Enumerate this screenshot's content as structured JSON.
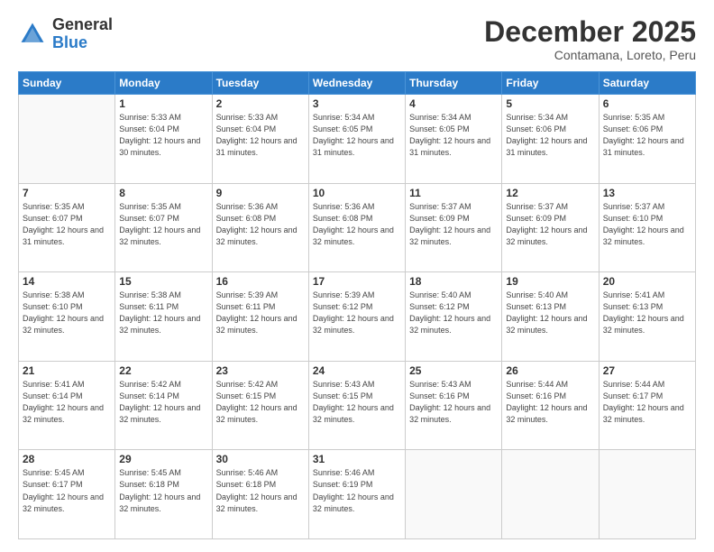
{
  "logo": {
    "general": "General",
    "blue": "Blue"
  },
  "header": {
    "month": "December 2025",
    "location": "Contamana, Loreto, Peru"
  },
  "weekdays": [
    "Sunday",
    "Monday",
    "Tuesday",
    "Wednesday",
    "Thursday",
    "Friday",
    "Saturday"
  ],
  "weeks": [
    [
      {
        "day": "",
        "sunrise": "",
        "sunset": "",
        "daylight": ""
      },
      {
        "day": "1",
        "sunrise": "Sunrise: 5:33 AM",
        "sunset": "Sunset: 6:04 PM",
        "daylight": "Daylight: 12 hours and 30 minutes."
      },
      {
        "day": "2",
        "sunrise": "Sunrise: 5:33 AM",
        "sunset": "Sunset: 6:04 PM",
        "daylight": "Daylight: 12 hours and 31 minutes."
      },
      {
        "day": "3",
        "sunrise": "Sunrise: 5:34 AM",
        "sunset": "Sunset: 6:05 PM",
        "daylight": "Daylight: 12 hours and 31 minutes."
      },
      {
        "day": "4",
        "sunrise": "Sunrise: 5:34 AM",
        "sunset": "Sunset: 6:05 PM",
        "daylight": "Daylight: 12 hours and 31 minutes."
      },
      {
        "day": "5",
        "sunrise": "Sunrise: 5:34 AM",
        "sunset": "Sunset: 6:06 PM",
        "daylight": "Daylight: 12 hours and 31 minutes."
      },
      {
        "day": "6",
        "sunrise": "Sunrise: 5:35 AM",
        "sunset": "Sunset: 6:06 PM",
        "daylight": "Daylight: 12 hours and 31 minutes."
      }
    ],
    [
      {
        "day": "7",
        "sunrise": "Sunrise: 5:35 AM",
        "sunset": "Sunset: 6:07 PM",
        "daylight": "Daylight: 12 hours and 31 minutes."
      },
      {
        "day": "8",
        "sunrise": "Sunrise: 5:35 AM",
        "sunset": "Sunset: 6:07 PM",
        "daylight": "Daylight: 12 hours and 32 minutes."
      },
      {
        "day": "9",
        "sunrise": "Sunrise: 5:36 AM",
        "sunset": "Sunset: 6:08 PM",
        "daylight": "Daylight: 12 hours and 32 minutes."
      },
      {
        "day": "10",
        "sunrise": "Sunrise: 5:36 AM",
        "sunset": "Sunset: 6:08 PM",
        "daylight": "Daylight: 12 hours and 32 minutes."
      },
      {
        "day": "11",
        "sunrise": "Sunrise: 5:37 AM",
        "sunset": "Sunset: 6:09 PM",
        "daylight": "Daylight: 12 hours and 32 minutes."
      },
      {
        "day": "12",
        "sunrise": "Sunrise: 5:37 AM",
        "sunset": "Sunset: 6:09 PM",
        "daylight": "Daylight: 12 hours and 32 minutes."
      },
      {
        "day": "13",
        "sunrise": "Sunrise: 5:37 AM",
        "sunset": "Sunset: 6:10 PM",
        "daylight": "Daylight: 12 hours and 32 minutes."
      }
    ],
    [
      {
        "day": "14",
        "sunrise": "Sunrise: 5:38 AM",
        "sunset": "Sunset: 6:10 PM",
        "daylight": "Daylight: 12 hours and 32 minutes."
      },
      {
        "day": "15",
        "sunrise": "Sunrise: 5:38 AM",
        "sunset": "Sunset: 6:11 PM",
        "daylight": "Daylight: 12 hours and 32 minutes."
      },
      {
        "day": "16",
        "sunrise": "Sunrise: 5:39 AM",
        "sunset": "Sunset: 6:11 PM",
        "daylight": "Daylight: 12 hours and 32 minutes."
      },
      {
        "day": "17",
        "sunrise": "Sunrise: 5:39 AM",
        "sunset": "Sunset: 6:12 PM",
        "daylight": "Daylight: 12 hours and 32 minutes."
      },
      {
        "day": "18",
        "sunrise": "Sunrise: 5:40 AM",
        "sunset": "Sunset: 6:12 PM",
        "daylight": "Daylight: 12 hours and 32 minutes."
      },
      {
        "day": "19",
        "sunrise": "Sunrise: 5:40 AM",
        "sunset": "Sunset: 6:13 PM",
        "daylight": "Daylight: 12 hours and 32 minutes."
      },
      {
        "day": "20",
        "sunrise": "Sunrise: 5:41 AM",
        "sunset": "Sunset: 6:13 PM",
        "daylight": "Daylight: 12 hours and 32 minutes."
      }
    ],
    [
      {
        "day": "21",
        "sunrise": "Sunrise: 5:41 AM",
        "sunset": "Sunset: 6:14 PM",
        "daylight": "Daylight: 12 hours and 32 minutes."
      },
      {
        "day": "22",
        "sunrise": "Sunrise: 5:42 AM",
        "sunset": "Sunset: 6:14 PM",
        "daylight": "Daylight: 12 hours and 32 minutes."
      },
      {
        "day": "23",
        "sunrise": "Sunrise: 5:42 AM",
        "sunset": "Sunset: 6:15 PM",
        "daylight": "Daylight: 12 hours and 32 minutes."
      },
      {
        "day": "24",
        "sunrise": "Sunrise: 5:43 AM",
        "sunset": "Sunset: 6:15 PM",
        "daylight": "Daylight: 12 hours and 32 minutes."
      },
      {
        "day": "25",
        "sunrise": "Sunrise: 5:43 AM",
        "sunset": "Sunset: 6:16 PM",
        "daylight": "Daylight: 12 hours and 32 minutes."
      },
      {
        "day": "26",
        "sunrise": "Sunrise: 5:44 AM",
        "sunset": "Sunset: 6:16 PM",
        "daylight": "Daylight: 12 hours and 32 minutes."
      },
      {
        "day": "27",
        "sunrise": "Sunrise: 5:44 AM",
        "sunset": "Sunset: 6:17 PM",
        "daylight": "Daylight: 12 hours and 32 minutes."
      }
    ],
    [
      {
        "day": "28",
        "sunrise": "Sunrise: 5:45 AM",
        "sunset": "Sunset: 6:17 PM",
        "daylight": "Daylight: 12 hours and 32 minutes."
      },
      {
        "day": "29",
        "sunrise": "Sunrise: 5:45 AM",
        "sunset": "Sunset: 6:18 PM",
        "daylight": "Daylight: 12 hours and 32 minutes."
      },
      {
        "day": "30",
        "sunrise": "Sunrise: 5:46 AM",
        "sunset": "Sunset: 6:18 PM",
        "daylight": "Daylight: 12 hours and 32 minutes."
      },
      {
        "day": "31",
        "sunrise": "Sunrise: 5:46 AM",
        "sunset": "Sunset: 6:19 PM",
        "daylight": "Daylight: 12 hours and 32 minutes."
      },
      {
        "day": "",
        "sunrise": "",
        "sunset": "",
        "daylight": ""
      },
      {
        "day": "",
        "sunrise": "",
        "sunset": "",
        "daylight": ""
      },
      {
        "day": "",
        "sunrise": "",
        "sunset": "",
        "daylight": ""
      }
    ]
  ]
}
